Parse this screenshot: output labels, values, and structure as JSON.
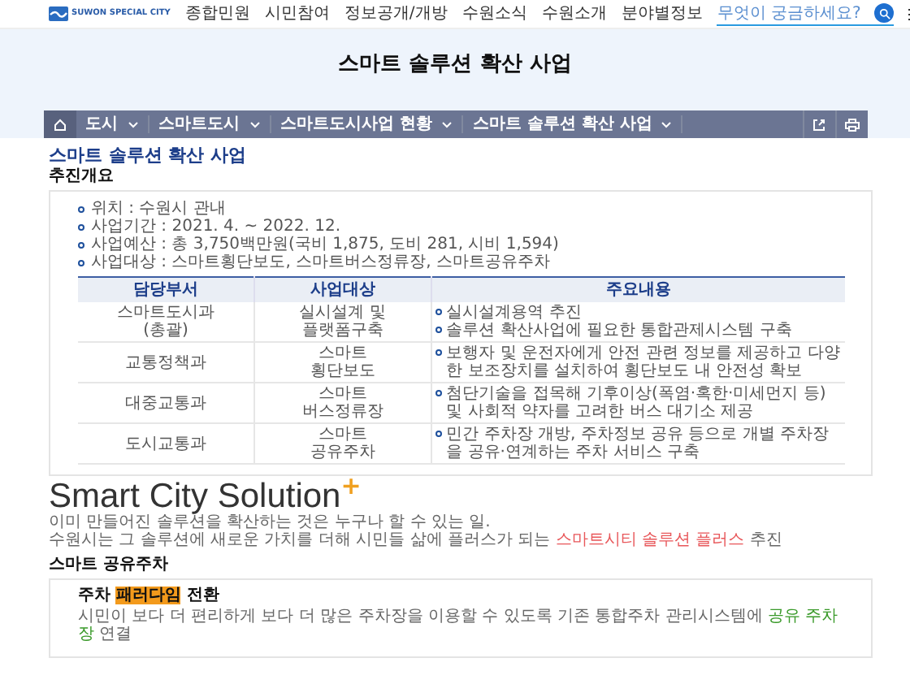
{
  "header": {
    "logo_text": "SUWON SPECIAL CITY",
    "menu": [
      "종합민원",
      "시민참여",
      "정보공개/개방",
      "수원소식",
      "수원소개",
      "분야별정보"
    ],
    "search": {
      "placeholder": "무엇이 궁금하세요?"
    }
  },
  "page_title": "스마트 솔루션 확산 사업",
  "breadcrumb": [
    "도시",
    "스마트도시",
    "스마트도시사업 현황",
    "스마트 솔루션 확산 사업"
  ],
  "heading": "스마트 솔루션 확산 사업",
  "overview": {
    "title": "추진개요",
    "items": [
      "위치 : 수원시 관내",
      "사업기간 : 2021. 4. ~ 2022. 12.",
      "사업예산 : 총 3,750백만원(국비 1,875, 도비 281, 시비 1,594)",
      "사업대상 : 스마트횡단보도, 스마트버스정류장, 스마트공유주차"
    ],
    "table": {
      "columns": [
        "담당부서",
        "사업대상",
        "주요내용"
      ],
      "rows": [
        {
          "dept": [
            "스마트도시과",
            "(총괄)"
          ],
          "target": [
            "실시설계 및",
            "플랫폼구축"
          ],
          "content": [
            "실시설계용역 추진",
            "솔루션 확산사업에 필요한 통합관제시스템 구축"
          ]
        },
        {
          "dept": [
            "교통정책과"
          ],
          "target": [
            "스마트",
            "횡단보도"
          ],
          "content": [
            "보행자 및 운전자에게 안전 관련 정보를 제공하고 다양한 보조장치를 설치하여 횡단보도 내 안전성 확보"
          ]
        },
        {
          "dept": [
            "대중교통과"
          ],
          "target": [
            "스마트",
            "버스정류장"
          ],
          "content": [
            "첨단기술을 접목해 기후이상(폭염·혹한·미세먼지 등) 및 사회적 약자를 고려한 버스 대기소 제공"
          ]
        },
        {
          "dept": [
            "도시교통과"
          ],
          "target": [
            "스마트",
            "공유주차"
          ],
          "content": [
            "민간 주차장 개방, 주차정보 공유 등으로 개별 주차장을 공유·연계하는 주차 서비스 구축"
          ]
        }
      ]
    }
  },
  "solution": {
    "title": "Smart City Solution",
    "plus": "+",
    "lines": [
      [
        {
          "kind": "plain",
          "text": "이미 만들어진 솔루션을 확산하는 것은 누구나 할 수 있는 일."
        }
      ],
      [
        {
          "kind": "plain",
          "text": "수원시는 그 솔루션에 새로운 가치를 더해 시민들 삶에 플러스가 되는 "
        },
        {
          "kind": "red",
          "text": "스마트시티 솔루션 플러스"
        },
        {
          "kind": "plain",
          "text": " 추진"
        }
      ]
    ]
  },
  "sharing": {
    "title": "스마트 공유주차",
    "box_title": [
      {
        "kind": "plain",
        "text": "주차 "
      },
      {
        "kind": "marker",
        "text": "패러다임"
      },
      {
        "kind": "plain",
        "text": " 전환"
      }
    ],
    "text": [
      {
        "kind": "plain",
        "text": "시민이 보다 더 편리하게 보다 더 많은 주차장을 이용할 수 있도록 기존 통합주차 관리시스템에 "
      },
      {
        "kind": "green",
        "text": "공유 주차장"
      },
      {
        "kind": "plain",
        "text": " 연결"
      }
    ]
  }
}
